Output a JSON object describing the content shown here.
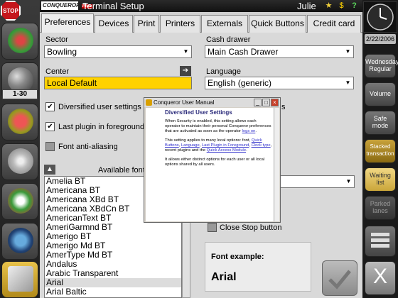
{
  "window": {
    "brand": "CONQUEROR",
    "brand_tag": "Plus",
    "title": "Terminal Setup",
    "user": "Julie",
    "icons": [
      "star-icon",
      "dollar-icon",
      "help-icon"
    ]
  },
  "tabs": [
    {
      "label": "Preferences",
      "active": true
    },
    {
      "label": "Devices"
    },
    {
      "label": "Print"
    },
    {
      "label": "Printers"
    },
    {
      "label": "Externals"
    },
    {
      "label": "Quick Buttons"
    },
    {
      "label": "Credit card"
    }
  ],
  "preferences": {
    "sector_label": "Sector",
    "sector_value": "Bowling",
    "cash_drawer_label": "Cash drawer",
    "cash_drawer_value": "Main Cash Drawer",
    "center_label": "Center",
    "center_value": "Local Default",
    "language_label": "Language",
    "language_value": "English (generic)",
    "checkboxes": [
      {
        "label": "Diversified user settings",
        "checked": true
      },
      {
        "label": "Last plugin in foreground",
        "checked": true
      },
      {
        "label": "Font anti-aliasing",
        "checked": false
      }
    ],
    "right_checkbox_partial": "s",
    "close_stop_label": "Close Stop button",
    "available_fonts_label": "Available fonts",
    "fonts": [
      "Amelia BT",
      "Americana BT",
      "Americana XBd BT",
      "Americana XBdCn BT",
      "AmericanText BT",
      "AmeriGarmnd BT",
      "Amerigo BT",
      "Amerigo Md BT",
      "AmerType Md BT",
      "Andalus",
      "Arabic Transparent",
      "Arial",
      "Arial Baltic"
    ],
    "selected_font": "Arial",
    "font_example_label": "Font example:",
    "font_example_value": "Arial"
  },
  "left_sidebar": {
    "stop_label": "STOP",
    "range_label": "1-30"
  },
  "right_sidebar": {
    "date": "2/22/2006",
    "buttons": [
      {
        "label": "Wednesday Regular",
        "style": "normal"
      },
      {
        "label": "Volume",
        "style": "normal"
      },
      {
        "label": "Safe mode",
        "style": "normal"
      },
      {
        "label": "Stacked transaction",
        "style": "gold"
      },
      {
        "label": "Waiting list",
        "style": "gold2"
      },
      {
        "label": "Parked lanes",
        "style": "dim"
      }
    ],
    "close_label": "X"
  },
  "dialog": {
    "title": "Conqueror User Manual",
    "heading": "Diversified User Settings",
    "p1": "When Security is enabled, this setting allows each operator to maintain their personal Conqueror preferences that are activated as soon as the operator ",
    "p1_link": "logs on",
    "p2a": "This setting applies to many local options: font, ",
    "p2_links": [
      "Quick Buttons",
      "Language",
      "Last Plugin in Foreground",
      "Clock type"
    ],
    "p2b": "recent plugins and the ",
    "p2_link_last": "Quick Access Module",
    "p3": "It allows either distinct options for each user or all local options shared by all users."
  },
  "colors": {
    "accent_yellow": "#ffd200",
    "stop_red": "#c4161c",
    "gold_button": "#c8a23a"
  }
}
